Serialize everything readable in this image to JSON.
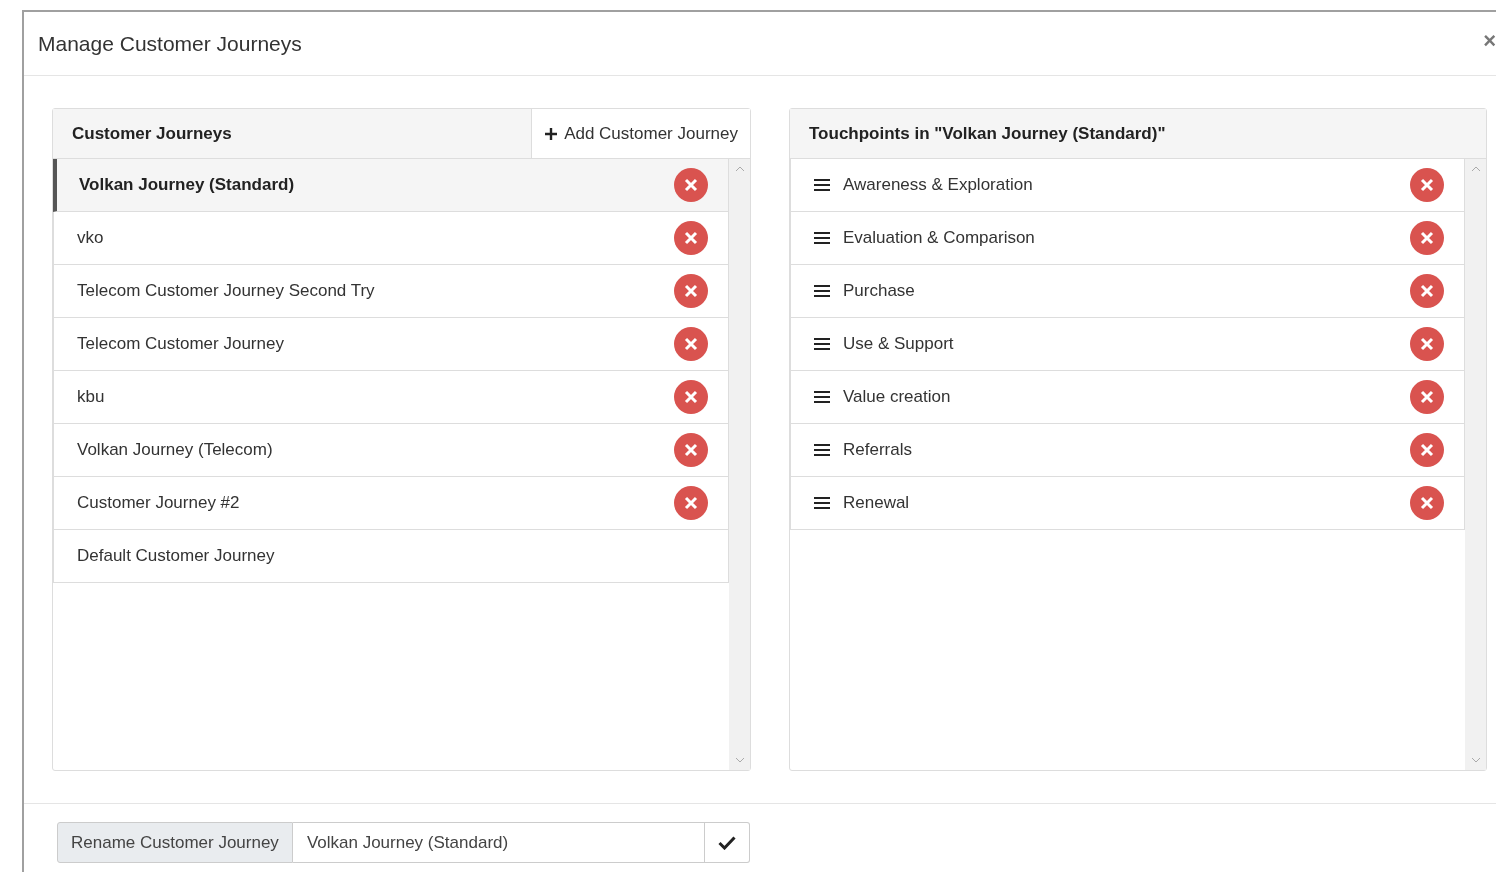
{
  "dialog": {
    "title": "Manage Customer Journeys",
    "close_label": "×"
  },
  "journeys_panel": {
    "title": "Customer Journeys",
    "add_button": "Add Customer Journey",
    "items": [
      {
        "label": "Volkan Journey (Standard)",
        "selected": true,
        "deletable": true
      },
      {
        "label": "vko",
        "selected": false,
        "deletable": true
      },
      {
        "label": "Telecom Customer Journey Second Try",
        "selected": false,
        "deletable": true
      },
      {
        "label": "Telecom Customer Journey",
        "selected": false,
        "deletable": true
      },
      {
        "label": "kbu",
        "selected": false,
        "deletable": true
      },
      {
        "label": "Volkan Journey (Telecom)",
        "selected": false,
        "deletable": true
      },
      {
        "label": "Customer Journey #2",
        "selected": false,
        "deletable": true
      },
      {
        "label": "Default Customer Journey",
        "selected": false,
        "deletable": false
      }
    ]
  },
  "touchpoints_panel": {
    "title": "Touchpoints in \"Volkan Journey (Standard)\"",
    "items": [
      {
        "label": "Awareness & Exploration"
      },
      {
        "label": "Evaluation & Comparison"
      },
      {
        "label": "Purchase"
      },
      {
        "label": "Use & Support"
      },
      {
        "label": "Value creation"
      },
      {
        "label": "Referrals"
      },
      {
        "label": "Renewal"
      }
    ]
  },
  "rename": {
    "label": "Rename Customer Journey",
    "value": "Volkan Journey (Standard)"
  }
}
